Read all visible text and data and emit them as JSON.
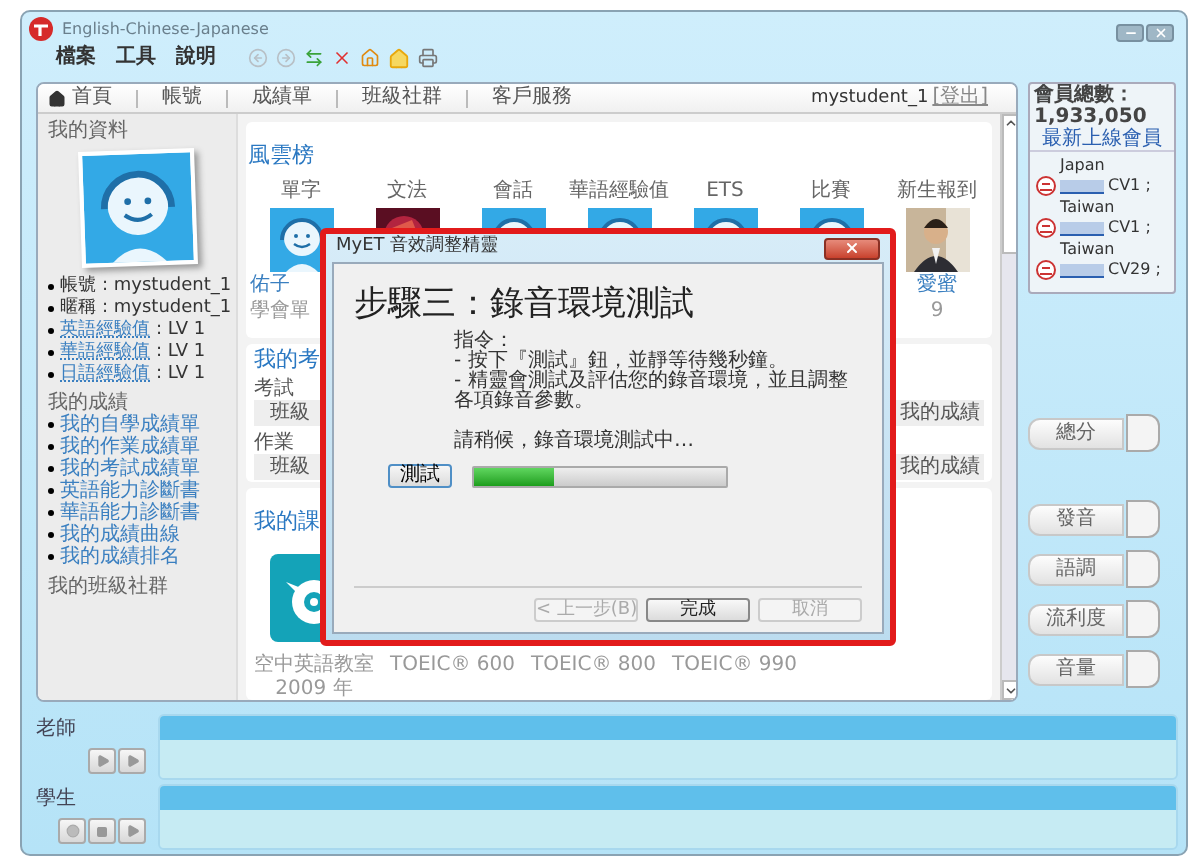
{
  "window": {
    "title": "English-Chinese-Japanese"
  },
  "menu": [
    "檔案",
    "工具",
    "說明"
  ],
  "nav": {
    "tabs": [
      "首頁",
      "帳號",
      "成績單",
      "班級社群",
      "客戶服務"
    ],
    "user": "mystudent_1",
    "logout": "[登出]"
  },
  "profile": {
    "title": "我的資料",
    "fields": [
      {
        "label": "帳號",
        "value": ": mystudent_1",
        "kind": "plain"
      },
      {
        "label": "暱稱",
        "value": ": mystudent_1",
        "kind": "plain"
      },
      {
        "label": "英語經驗值",
        "value": ": LV 1",
        "kind": "link"
      },
      {
        "label": "華語經驗值",
        "value": ": LV 1",
        "kind": "link"
      },
      {
        "label": "日語經驗值",
        "value": ": LV 1",
        "kind": "link"
      }
    ]
  },
  "grades": {
    "title": "我的成績",
    "links": [
      "我的自學成績單",
      "我的作業成績單",
      "我的考試成績單",
      "英語能力診斷書",
      "華語能力診斷書",
      "我的成績曲線",
      "我的成績排名"
    ]
  },
  "class_group": "我的班級社群",
  "ranking": {
    "title": "風雲榜",
    "columns": [
      {
        "label": "單字",
        "kind": "avatar",
        "captions": [
          "佑子",
          "學會單"
        ]
      },
      {
        "label": "文法",
        "kind": "picture"
      },
      {
        "label": "會話",
        "kind": "avatar"
      },
      {
        "label": "華語經驗值",
        "kind": "avatar"
      },
      {
        "label": "ETS",
        "kind": "avatar"
      },
      {
        "label": "比賽",
        "kind": "avatar"
      },
      {
        "label": "新生報到",
        "kind": "picture",
        "captions": [
          "愛蜜",
          "9"
        ]
      }
    ]
  },
  "exams": {
    "title": "我的考",
    "groups": [
      {
        "label": "考試",
        "cells": [
          "班級",
          "我的成績"
        ]
      },
      {
        "label": "作業",
        "cells": [
          "班級",
          "我的成績"
        ]
      }
    ]
  },
  "courses": {
    "title": "我的課",
    "items": [
      {
        "kind": "logo",
        "captions": [
          "空中英語教室",
          "2009 年"
        ]
      },
      {
        "kind": "caption_only",
        "captions": [
          "TOEIC® 600"
        ]
      },
      {
        "kind": "caption_only",
        "captions": [
          "TOEIC® 800"
        ]
      },
      {
        "kind": "caption_only",
        "captions": [
          "TOEIC® 990"
        ]
      }
    ]
  },
  "members": {
    "total": "會員總數：1,933,050",
    "latest": "最新上線會員",
    "entries": [
      {
        "country": "Japan",
        "level": "CV1 ;"
      },
      {
        "country": "Taiwan",
        "level": "CV1 ;"
      },
      {
        "country": "Taiwan",
        "level": "CV29 ;"
      }
    ]
  },
  "scores": [
    "總分",
    "發音",
    "語調",
    "流利度",
    "音量"
  ],
  "teacher": {
    "label": "老師"
  },
  "student": {
    "label": "學生"
  },
  "dialog": {
    "title": "MyET 音效調整精靈",
    "heading": "步驟三：錄音環境測試",
    "instructions": [
      "指令：",
      "- 按下『測試』鈕，並靜等待幾秒鐘。",
      "- 精靈會測試及評估您的錄音環境，並且調整各項錄音參數。"
    ],
    "status": "請稍候，錄音環境測試中…",
    "test_button": "測試",
    "progress": {
      "level": 0.32
    },
    "buttons": [
      {
        "label": "< 上一步(B)",
        "disabled": true
      },
      {
        "label": "完成",
        "disabled": false
      },
      {
        "label": "取消",
        "disabled": true
      }
    ]
  }
}
